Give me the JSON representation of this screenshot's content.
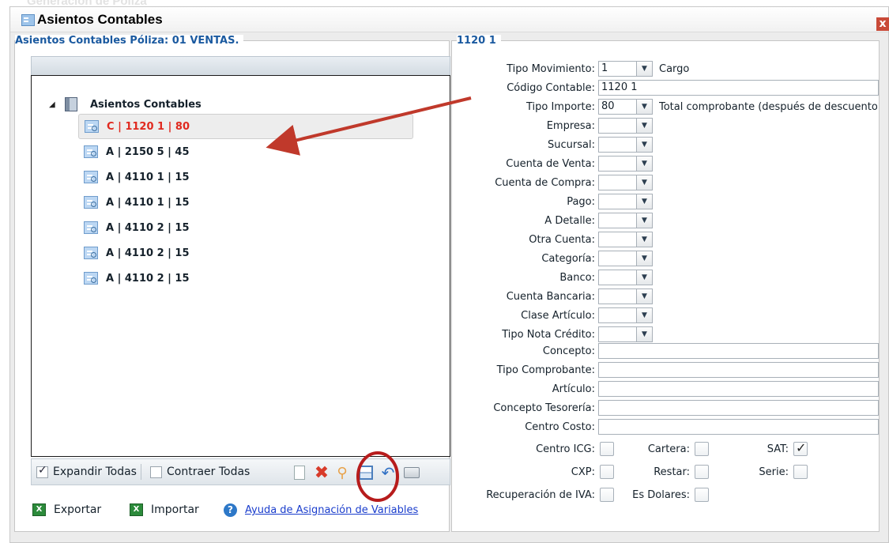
{
  "background_title": "Generacion de Poliza",
  "window": {
    "title": "Asientos Contables",
    "close_glyph": "x"
  },
  "left": {
    "legend": "Asientos Contables Póliza: 01 VENTAS.",
    "tree": {
      "root_label": "Asientos Contables",
      "items": [
        {
          "label": "C | 1120 1 | 80",
          "selected": true
        },
        {
          "label": "A | 2150 5 | 45",
          "selected": false
        },
        {
          "label": "A | 4110 1 | 15",
          "selected": false
        },
        {
          "label": "A | 4110 1 | 15",
          "selected": false
        },
        {
          "label": "A | 4110 2 | 15",
          "selected": false
        },
        {
          "label": "A | 4110 2 | 15",
          "selected": false
        },
        {
          "label": "A | 4110 2 | 15",
          "selected": false
        }
      ]
    },
    "toolbar": {
      "expand_label": "Expandir Todas",
      "expand_checked": true,
      "collapse_label": "Contraer Todas",
      "collapse_checked": false
    },
    "actions": {
      "export_label": "Exportar",
      "import_label": "Importar",
      "help_label": "Ayuda de Asignación de Variables"
    }
  },
  "right": {
    "legend": "1120 1",
    "tipo_movimiento": {
      "label": "Tipo Movimiento:",
      "value": "1",
      "desc": "Cargo"
    },
    "codigo_contable": {
      "label": "Código Contable:",
      "value": "1120 1"
    },
    "tipo_importe": {
      "label": "Tipo Importe:",
      "value": "80",
      "desc": "Total comprobante (después de descuento)"
    },
    "selects": [
      {
        "label": "Empresa:",
        "value": ""
      },
      {
        "label": "Sucursal:",
        "value": ""
      },
      {
        "label": "Cuenta de Venta:",
        "value": ""
      },
      {
        "label": "Cuenta de Compra:",
        "value": ""
      },
      {
        "label": "Pago:",
        "value": ""
      },
      {
        "label": "A Detalle:",
        "value": ""
      },
      {
        "label": "Otra Cuenta:",
        "value": ""
      },
      {
        "label": "Categoría:",
        "value": ""
      },
      {
        "label": "Banco:",
        "value": ""
      },
      {
        "label": "Cuenta Bancaria:",
        "value": ""
      },
      {
        "label": "Clase Artículo:",
        "value": ""
      },
      {
        "label": "Tipo Nota Crédito:",
        "value": ""
      }
    ],
    "texts": [
      {
        "label": "Concepto:",
        "value": ""
      },
      {
        "label": "Tipo Comprobante:",
        "value": ""
      },
      {
        "label": "Artículo:",
        "value": ""
      },
      {
        "label": "Concepto Tesorería:",
        "value": ""
      },
      {
        "label": "Centro Costo:",
        "value": ""
      }
    ],
    "checkboxes": [
      [
        {
          "label": "Centro ICG:",
          "checked": false
        },
        {
          "label": "Cartera:",
          "checked": false
        },
        {
          "label": "SAT:",
          "checked": true
        }
      ],
      [
        {
          "label": "CXP:",
          "checked": false
        },
        {
          "label": "Restar:",
          "checked": false
        },
        {
          "label": "Serie:",
          "checked": false
        }
      ],
      [
        {
          "label": "Recuperación de IVA:",
          "checked": false
        },
        {
          "label": "Es Dolares:",
          "checked": false
        }
      ]
    ]
  },
  "annotation_color": "#c0392b"
}
